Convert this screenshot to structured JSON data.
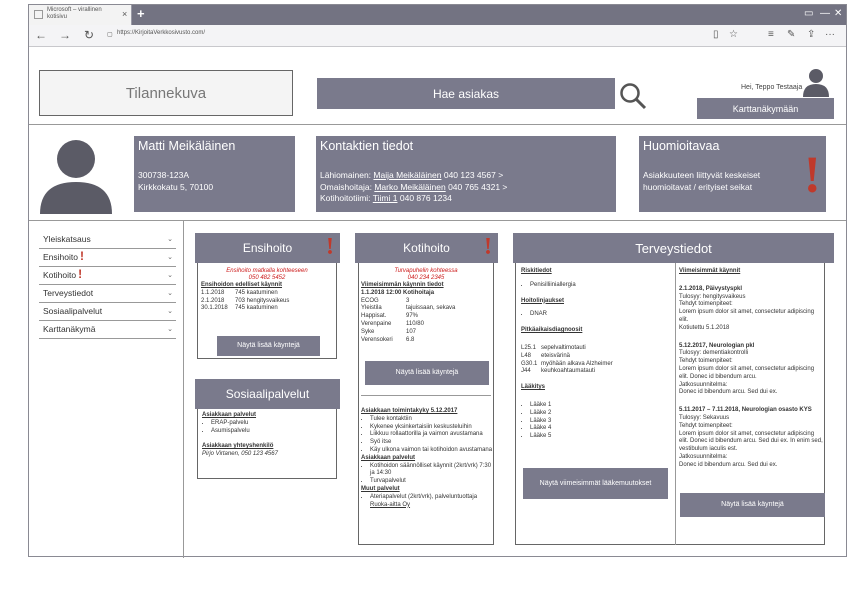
{
  "browser": {
    "tab_title": "Microsoft – virallinen kotisivu",
    "tab_close": "×",
    "new_tab": "+",
    "url": "https://KirjoitaVerkkosivusto.com/",
    "nav": {
      "back": "←",
      "forward": "→",
      "refresh": "↻",
      "lock": "🔒"
    },
    "win": {
      "restore": "▭",
      "minimize": "—",
      "maximize": "☐",
      "close": "✕"
    },
    "tools": {
      "reading": "▯",
      "favorite": "☆",
      "hub": "≡",
      "notes": "✎",
      "share": "⇪",
      "more": "···"
    }
  },
  "header": {
    "snapshot": "Tilannekuva",
    "search": "Hae asiakas",
    "user_greeting": "Hei, Teppo Testaaja",
    "map_button": "Karttanäkymään"
  },
  "patient": {
    "name": "Matti Meikäläinen",
    "id": "300738-123A",
    "address": "Kirkkokatu 5, 70100"
  },
  "contacts": {
    "title": "Kontaktien tiedot",
    "lines": [
      {
        "role": "Lähiomainen:",
        "name": "Maija Meikäläinen",
        "phone": "040 123 4567 >"
      },
      {
        "role": "Omaishoitaja:",
        "name": "Marko Meikäläinen",
        "phone": "040 765 4321 >"
      },
      {
        "role": "Kotihoitotiimi:",
        "name": "Tiimi 1",
        "phone": "040 876 1234"
      }
    ]
  },
  "notes": {
    "title": "Huomioitavaa",
    "text": "Asiakkuuteen liittyvät keskeiset huomioitavat / erityiset seikat",
    "mark": "!"
  },
  "leftnav": {
    "items": [
      {
        "label": "Yleiskatsaus",
        "alert": ""
      },
      {
        "label": "Ensihoito",
        "alert": "!"
      },
      {
        "label": "Kotihoito",
        "alert": "!"
      },
      {
        "label": "Terveystiedot",
        "alert": ""
      },
      {
        "label": "Sosiaalipalvelut",
        "alert": ""
      },
      {
        "label": "Karttanäkymä",
        "alert": ""
      }
    ],
    "chevron": "⌄"
  },
  "ensihoito": {
    "title": "Ensihoito",
    "mark": "!",
    "alert1": "Ensihoito matkalla kohteeseen",
    "alert2": "050 482 5452",
    "sub": "Ensihoidon edelliset käynnit",
    "visits": [
      [
        "1.1.2018",
        "745 kaatuminen"
      ],
      [
        "2.1.2018",
        "703 hengitysvaikeus"
      ],
      [
        "30.1.2018",
        "745 kaatuminen"
      ]
    ],
    "button": "Näytä lisää käyntejä"
  },
  "sosiaali": {
    "title": "Sosiaalipalvelut",
    "sub1": "Asiakkaan palvelut",
    "services": [
      "ERAP-palvelu",
      "Asumispalvelu"
    ],
    "sub2": "Asiakkaan yhteyshenkilö",
    "contact": "Pirjo Virtanen, 050 123 4567"
  },
  "kotihoito": {
    "title": "Kotihoito",
    "mark": "!",
    "alert1": "Turvapuhelin kohteessa",
    "alert2": "040 234 2345",
    "sub": "Viimeisimmän käynnin tiedot",
    "visit": "1.1.2018 12:00 Kotihoitaja",
    "vitals": [
      [
        "ECOG",
        "3"
      ],
      [
        "Yleistila",
        "tajuissaan, sekava"
      ],
      [
        "Happisat.",
        "97%"
      ],
      [
        "Verenpaine",
        "110/80"
      ],
      [
        "Syke",
        "107"
      ],
      [
        "Verensokeri",
        "6.8"
      ]
    ],
    "button": "Näytä lisää käyntejä",
    "sub2": "Asiakkaan toimintakyky 5.12.2017",
    "ability": [
      "Tulee kontaktiin",
      "Kykenee yksinkertaisiin keskusteluihin",
      "Liikkuu rollaattorilla ja vaimon avustamana",
      "Syö itse",
      "Käy ulkona vaimon tai kotihoidon avustamana"
    ],
    "sub3": "Asiakkaan palvelut",
    "services": [
      "Kotihoidon säännölliset käynnit (2krt/vrk) 7:30 ja 14:30",
      "Turvapalvelut"
    ],
    "sub4": "Muut palvelut",
    "other": [
      "Ateriapalvelut (2krt/vrk), palveluntuottaja"
    ],
    "other_link": "Ruoka-aitta Oy"
  },
  "terveys": {
    "title": "Terveystiedot",
    "risk_title": "Riskitiedot",
    "risks": [
      "Penisilliiniallergia"
    ],
    "care_title": "Hoitolinjaukset",
    "care": [
      "DNAR"
    ],
    "diag_title": "Pitkäaikaisdiagnoosit",
    "diagnoses": [
      [
        "L25.1",
        "sepelvaltimotauti"
      ],
      [
        "L48",
        "eteisvärinä"
      ],
      [
        "G30.1",
        "myöhään alkava Alzheimer"
      ],
      [
        "J44",
        "keuhkoahtaumatauti"
      ]
    ],
    "med_title": "Lääkitys",
    "meds": [
      "Lääke 1",
      "Lääke 2",
      "Lääke 3",
      "Lääke 4",
      "Lääke 5"
    ],
    "med_button": "Näytä viimeisimmät lääkemuutokset",
    "visits_title": "Viimeisimmät käynnit",
    "visits": [
      {
        "head": "2.1.2018, Päivystyspkl",
        "lines": [
          "Tulosyy: hengitysvaikeus",
          "Tehdyt toimenpiteet:",
          "Lorem ipsum dolor sit amet, consectetur adipiscing elit.",
          "Kotiutettu 5.1.2018"
        ]
      },
      {
        "head": "5.12.2017, Neurologian pkl",
        "lines": [
          "Tulosyy: dementiakontrolli",
          "Tehdyt toimenpiteet:",
          "Lorem ipsum dolor sit amet, consectetur adipiscing elit. Donec id bibendum arcu.",
          "Jatkosuunnitelma:",
          "Donec id bibendum arcu. Sed dui ex."
        ]
      },
      {
        "head": "5.11.2017 – 7.11.2018, Neurologian osasto KYS",
        "lines": [
          "Tulosyy: Sekavuus",
          "Tehdyt toimenpiteet:",
          "Lorem ipsum dolor sit amet, consectetur adipiscing elit. Donec id bibendum arcu. Sed dui ex. In enim sed, vestibulum iaculis est.",
          "Jatkosuunnitelma:",
          "Donec id bibendum arcu. Sed dui ex."
        ]
      }
    ],
    "visits_button": "Näytä lisää käyntejä"
  }
}
